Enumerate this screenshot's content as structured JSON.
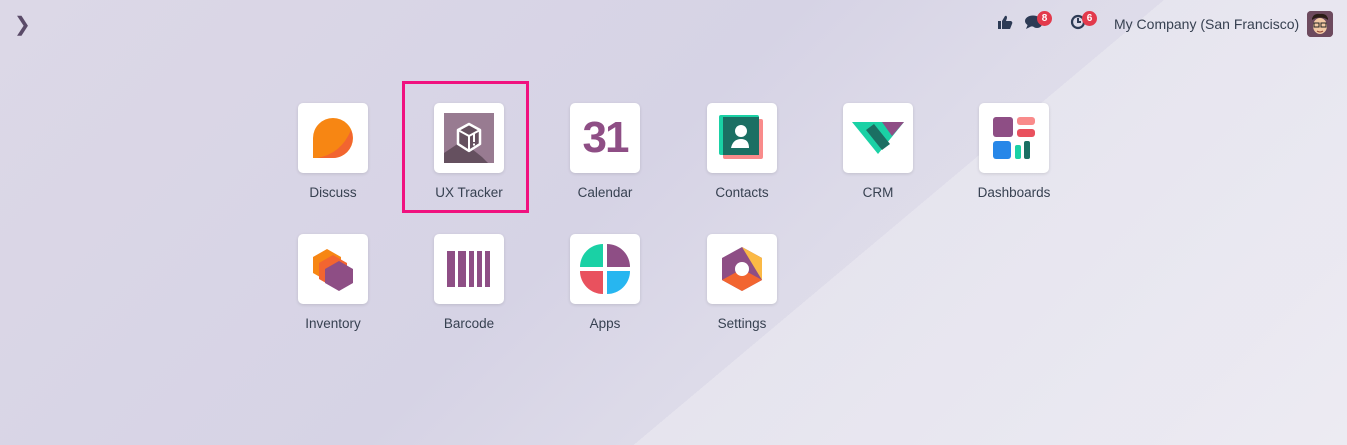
{
  "topbar": {
    "toggle_icon": "chevron-right-icon",
    "messages_count": "8",
    "activities_count": "6",
    "company": "My Company (San Francisco)"
  },
  "apps": [
    {
      "label": "Discuss",
      "icon": "discuss-icon"
    },
    {
      "label": "UX Tracker",
      "icon": "ux-tracker-icon",
      "highlighted": true
    },
    {
      "label": "Calendar",
      "icon": "calendar-icon",
      "icon_text": "31"
    },
    {
      "label": "Contacts",
      "icon": "contacts-icon"
    },
    {
      "label": "CRM",
      "icon": "crm-icon"
    },
    {
      "label": "Dashboards",
      "icon": "dashboards-icon"
    },
    {
      "label": "Inventory",
      "icon": "inventory-icon"
    },
    {
      "label": "Barcode",
      "icon": "barcode-icon"
    },
    {
      "label": "Apps",
      "icon": "apps-icon"
    },
    {
      "label": "Settings",
      "icon": "settings-icon"
    }
  ],
  "colors": {
    "highlight": "#f0117f",
    "badge": "#e33a4c"
  }
}
